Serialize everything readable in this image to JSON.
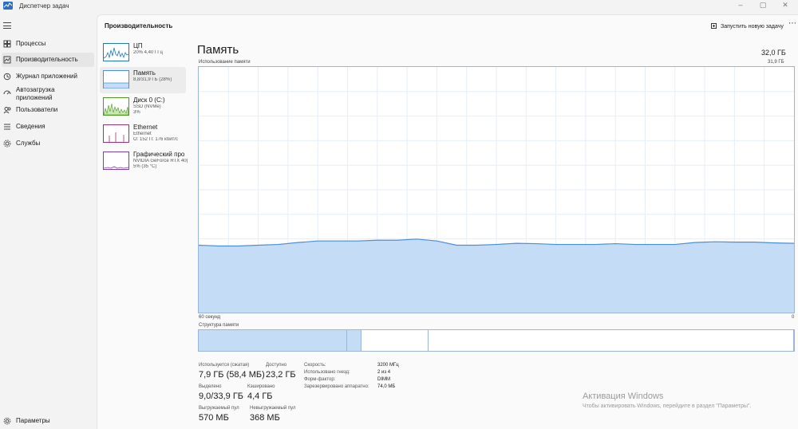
{
  "window": {
    "title": "Диспетчер задач",
    "controls": [
      "–",
      "▢",
      "✕"
    ]
  },
  "nav": {
    "items": [
      {
        "label": "Процессы",
        "icon": "processes-icon"
      },
      {
        "label": "Производительность",
        "icon": "performance-icon",
        "active": true
      },
      {
        "label": "Журнал приложений",
        "icon": "app-history-icon"
      },
      {
        "label": "Автозагрузка приложений",
        "icon": "startup-apps-icon"
      },
      {
        "label": "Пользователи",
        "icon": "users-icon"
      },
      {
        "label": "Сведения",
        "icon": "details-icon"
      },
      {
        "label": "Службы",
        "icon": "services-icon"
      }
    ],
    "settings_label": "Параметры"
  },
  "header": {
    "title": "Производительность",
    "new_task_label": "Запустить новую задачу",
    "more_label": "⋯"
  },
  "resources": [
    {
      "name": "ЦП",
      "sub1": "20% 4,40 ГГц",
      "sub2": "",
      "color": "#1f7ab8"
    },
    {
      "name": "Память",
      "sub1": "8,8/31,9 ГБ (28%)",
      "sub2": "",
      "color": "#4a8fd8",
      "active": true
    },
    {
      "name": "Диск 0 (C:)",
      "sub1": "SSD (NVMe)",
      "sub2": "3%",
      "color": "#4d9a1e"
    },
    {
      "name": "Ethernet",
      "sub1": "Ethernet",
      "sub2": "О: 152 П: 176 кбит/с",
      "color": "#a2326e"
    },
    {
      "name": "Графический про",
      "sub1": "NVIDIA GeForce RTX 40(",
      "sub2": "5% (35 °C)",
      "color": "#7a3fb0"
    }
  ],
  "detail": {
    "title": "Память",
    "total": "32,0 ГБ",
    "usage_label": "Использование памяти",
    "usage_max": "31,9 ГБ",
    "x_left": "60 секунд",
    "x_right": "0",
    "structure_label": "Структура памяти",
    "structure_segments": [
      {
        "name": "in-use",
        "fraction": 0.249,
        "filled": true
      },
      {
        "name": "modified",
        "fraction": 0.025,
        "filled": true
      },
      {
        "name": "standby",
        "fraction": 0.112,
        "filled": false
      },
      {
        "name": "free",
        "fraction": 0.614,
        "filled": false
      }
    ]
  },
  "stats": {
    "in_use_label": "Используется (сжатая)",
    "in_use_value": "7,9 ГБ (58,4 МБ)",
    "available_label": "Доступно",
    "available_value": "23,2 ГБ",
    "committed_label": "Выделено",
    "committed_value": "9,0/33,9 ГБ",
    "cached_label": "Кэшировано",
    "cached_value": "4,4 ГБ",
    "paged_label": "Выгружаемый пул",
    "paged_value": "570 МБ",
    "nonpaged_label": "Невыгружаемый пул",
    "nonpaged_value": "368 МБ"
  },
  "hw": [
    {
      "label": "Скорость:",
      "value": "3200 МГц"
    },
    {
      "label": "Использовано гнезд:",
      "value": "2 из 4"
    },
    {
      "label": "Форм-фактор:",
      "value": "DIMM"
    },
    {
      "label": "Зарезервировано аппаратно:",
      "value": "74,0 МБ"
    }
  ],
  "watermark": {
    "title": "Активация Windows",
    "sub": "Чтобы активировать Windows, перейдите в раздел \"Параметры\"."
  },
  "chart_data": {
    "type": "area",
    "title": "Использование памяти",
    "xlabel": "",
    "ylabel": "",
    "x_range_label": [
      "60 секунд",
      "0"
    ],
    "ylim": [
      0,
      31.9
    ],
    "grid": true,
    "color": "#4a8fd8",
    "x": [
      60,
      58,
      56,
      54,
      52,
      50,
      48,
      46,
      44,
      42,
      40,
      38,
      36,
      34,
      32,
      30,
      28,
      26,
      24,
      22,
      20,
      18,
      16,
      14,
      12,
      10,
      8,
      6,
      4,
      2,
      0
    ],
    "values": [
      8.75,
      8.65,
      8.65,
      8.75,
      8.85,
      9.1,
      9.3,
      9.3,
      9.3,
      9.4,
      9.4,
      9.55,
      9.3,
      8.75,
      8.75,
      8.85,
      9.0,
      8.95,
      8.85,
      8.85,
      8.85,
      8.95,
      8.85,
      8.85,
      8.85,
      9.1,
      9.2,
      9.15,
      9.15,
      9.05,
      9.0
    ]
  }
}
